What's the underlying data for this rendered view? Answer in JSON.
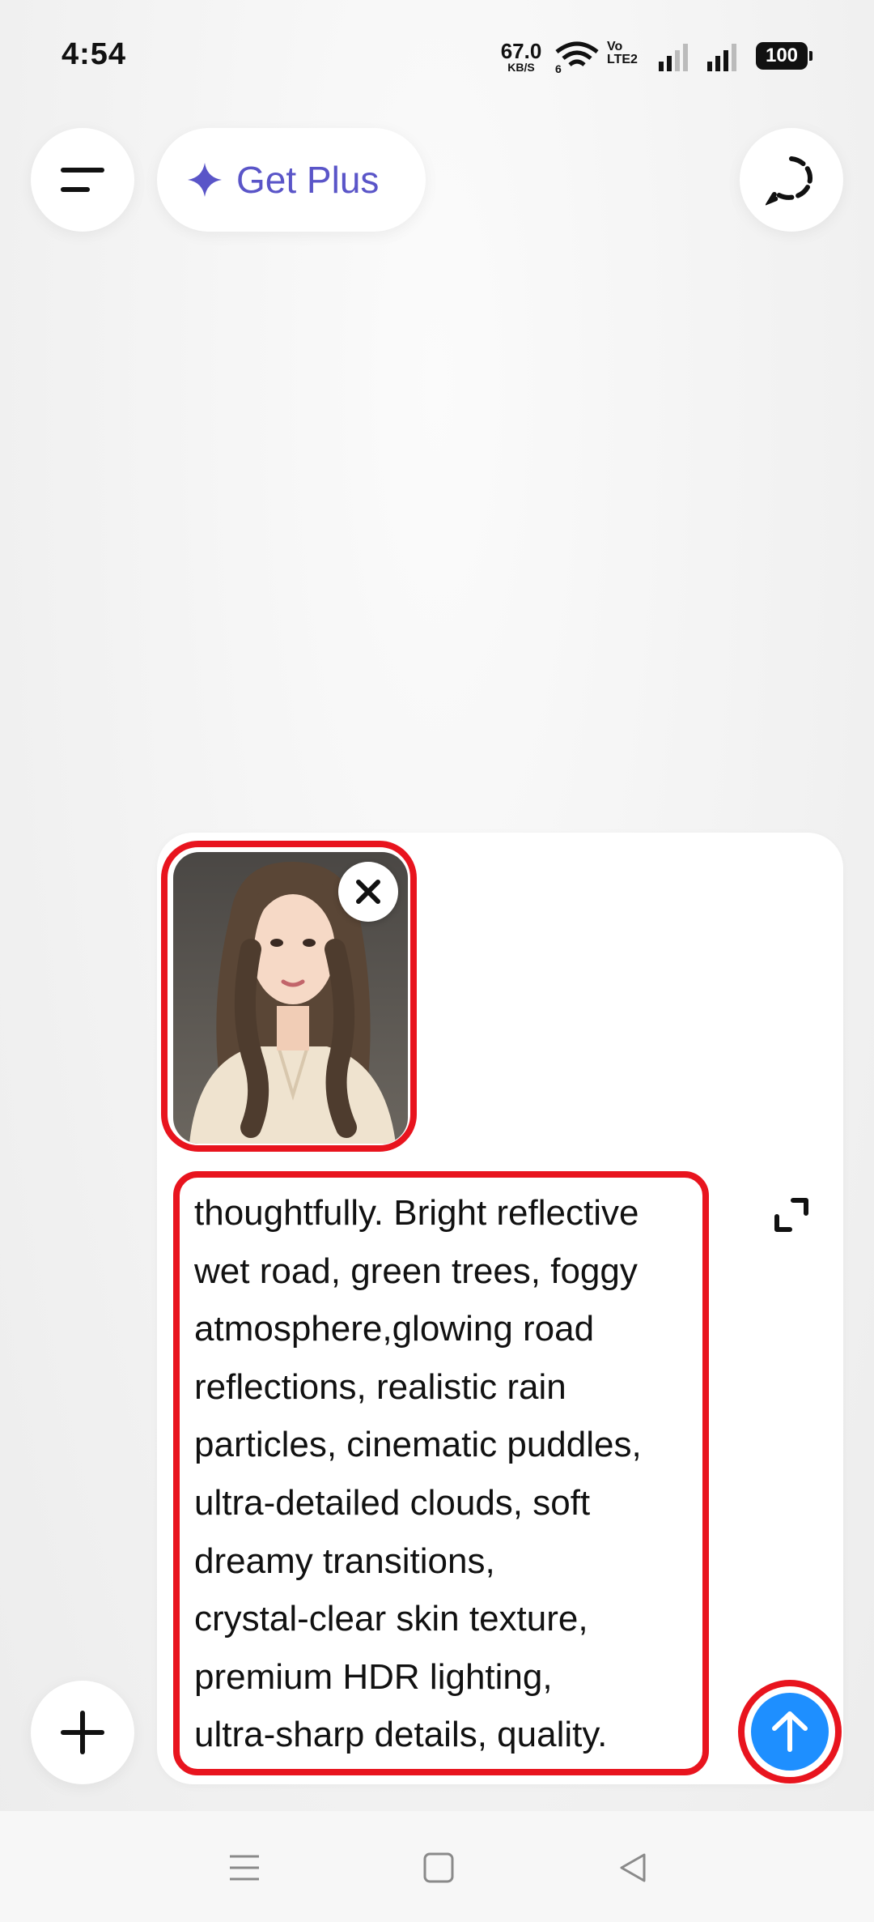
{
  "status_bar": {
    "time": "4:54",
    "net_speed_value": "67.0",
    "net_speed_unit": "KB/S",
    "wifi_label": "6",
    "volte_top": "Vo",
    "volte_bottom": "LTE2",
    "battery": "100"
  },
  "header": {
    "menu_icon": "menu-icon",
    "get_plus_label": "Get Plus",
    "sparkle_icon": "sparkle-icon",
    "temporary_chat_icon": "dashed-chat-icon",
    "accent_color": "#5a55c8"
  },
  "composer": {
    "attachment": {
      "alt": "portrait photo",
      "remove_icon": "close-icon"
    },
    "prompt_lines": [
      "thoughtfully. Bright reflective",
      "wet road, green trees, foggy",
      "atmosphere,glowing road",
      "reflections, realistic rain",
      "particles, cinematic puddles,",
      "ultra-detailed clouds, soft",
      "dreamy transitions,",
      "crystal-clear skin texture,",
      "premium HDR lighting,",
      "ultra-sharp details, quality."
    ],
    "expand_icon": "expand-icon",
    "add_icon": "plus-icon",
    "send_icon": "arrow-up-icon",
    "send_color": "#1e8fff",
    "highlight_color": "#e8141e"
  },
  "nav_bar": {
    "recents_icon": "recents-icon",
    "home_icon": "home-icon",
    "back_icon": "back-icon"
  }
}
